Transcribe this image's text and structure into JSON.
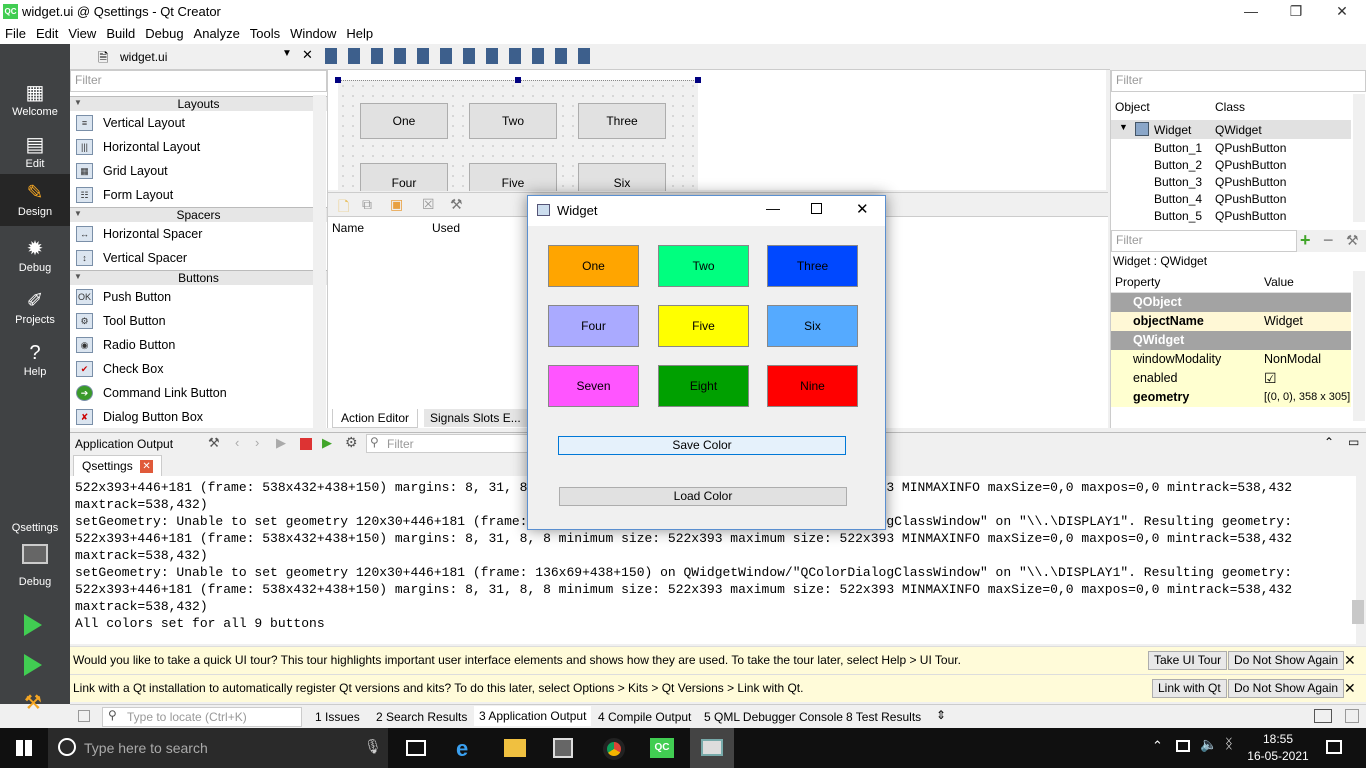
{
  "window": {
    "title": "widget.ui @ Qsettings - Qt Creator",
    "logo": "QC",
    "controls": [
      "—",
      "❐",
      "✕"
    ]
  },
  "menu": [
    "File",
    "Edit",
    "View",
    "Build",
    "Debug",
    "Analyze",
    "Tools",
    "Window",
    "Help"
  ],
  "modes": [
    {
      "label": "Welcome",
      "icon": "grid-icon"
    },
    {
      "label": "Edit",
      "icon": "document-icon"
    },
    {
      "label": "Design",
      "icon": "pencil-icon"
    },
    {
      "label": "Debug",
      "icon": "bug-icon"
    },
    {
      "label": "Projects",
      "icon": "wrench-icon"
    },
    {
      "label": "Help",
      "icon": "help-icon"
    }
  ],
  "kit": {
    "project": "Qsettings",
    "label": "Debug"
  },
  "editor": {
    "file": "widget.ui"
  },
  "widget_box": {
    "filter_placeholder": "Filter",
    "categories": [
      {
        "name": "Layouts",
        "items": [
          "Vertical Layout",
          "Horizontal Layout",
          "Grid Layout",
          "Form Layout"
        ]
      },
      {
        "name": "Spacers",
        "items": [
          "Horizontal Spacer",
          "Vertical Spacer"
        ]
      },
      {
        "name": "Buttons",
        "items": [
          "Push Button",
          "Tool Button",
          "Radio Button",
          "Check Box",
          "Command Link Button",
          "Dialog Button Box"
        ]
      }
    ]
  },
  "form_buttons": [
    "One",
    "Two",
    "Three",
    "Four",
    "Five",
    "Six"
  ],
  "action_editor": {
    "columns": [
      "Name",
      "Used"
    ],
    "tabs": [
      "Action Editor",
      "Signals Slots E..."
    ]
  },
  "object_inspector": {
    "filter_placeholder": "Filter",
    "columns": [
      "Object",
      "Class"
    ],
    "rows": [
      {
        "object": "Widget",
        "class": "QWidget"
      },
      {
        "object": "Button_1",
        "class": "QPushButton"
      },
      {
        "object": "Button_2",
        "class": "QPushButton"
      },
      {
        "object": "Button_3",
        "class": "QPushButton"
      },
      {
        "object": "Button_4",
        "class": "QPushButton"
      },
      {
        "object": "Button_5",
        "class": "QPushButton"
      }
    ]
  },
  "property_editor": {
    "filter_placeholder": "Filter",
    "caption": "Widget : QWidget",
    "columns": [
      "Property",
      "Value"
    ],
    "sections": [
      "QObject",
      "QWidget"
    ],
    "object_name": {
      "key": "objectName",
      "value": "Widget"
    },
    "window_modality": {
      "key": "windowModality",
      "value": "NonModal"
    },
    "enabled": {
      "key": "enabled",
      "value": "☑"
    },
    "geometry": {
      "key": "geometry",
      "value": "[(0, 0), 358 x 305]"
    }
  },
  "output": {
    "pane_title": "Application Output",
    "filter_placeholder": "Filter",
    "tab": "Qsettings",
    "lines": "522x393+446+181 (frame: 538x432+438+150) margins: 8, 31, 8, 8 minimum size: 522x393 maximum size: 522x393 MINMAXINFO maxSize=0,0 maxpos=0,0 mintrack=538,432\nmaxtrack=538,432)\nsetGeometry: Unable to set geometry 120x30+446+181 (frame: 136x69+438+150) on QWidgetWindow/\"QColorDialogClassWindow\" on \"\\\\.\\DISPLAY1\". Resulting geometry:\n522x393+446+181 (frame: 538x432+438+150) margins: 8, 31, 8, 8 minimum size: 522x393 maximum size: 522x393 MINMAXINFO maxSize=0,0 maxpos=0,0 mintrack=538,432\nmaxtrack=538,432)\nsetGeometry: Unable to set geometry 120x30+446+181 (frame: 136x69+438+150) on QWidgetWindow/\"QColorDialogClassWindow\" on \"\\\\.\\DISPLAY1\". Resulting geometry:\n522x393+446+181 (frame: 538x432+438+150) margins: 8, 31, 8, 8 minimum size: 522x393 maximum size: 522x393 MINMAXINFO maxSize=0,0 maxpos=0,0 mintrack=538,432\nmaxtrack=538,432)\nAll colors set for all 9 buttons"
  },
  "info_bars": [
    {
      "text": "Would you like to take a quick UI tour? This tour highlights important user interface elements and shows how they are used. To take the tour later, select Help > UI Tour.",
      "primary": "Take UI Tour",
      "secondary": "Do Not Show Again"
    },
    {
      "text": "Link with a Qt installation to automatically register Qt versions and kits? To do this later, select Options > Kits > Qt Versions > Link with Qt.",
      "primary": "Link with Qt",
      "secondary": "Do Not Show Again"
    }
  ],
  "status_bar": {
    "locator_placeholder": "Type to locate (Ctrl+K)",
    "panes": [
      "1  Issues",
      "2  Search Results",
      "3  Application Output",
      "4  Compile Output",
      "5  QML Debugger Console",
      "8  Test Results"
    ]
  },
  "dialog": {
    "title": "Widget",
    "buttons": [
      {
        "label": "One",
        "color": "#ffa500"
      },
      {
        "label": "Two",
        "color": "#00ff7f"
      },
      {
        "label": "Three",
        "color": "#0048ff"
      },
      {
        "label": "Four",
        "color": "#aaaaff"
      },
      {
        "label": "Five",
        "color": "#ffff00"
      },
      {
        "label": "Six",
        "color": "#55aaff"
      },
      {
        "label": "Seven",
        "color": "#ff55ff"
      },
      {
        "label": "Eight",
        "color": "#00a000"
      },
      {
        "label": "Nine",
        "color": "#ff0000"
      }
    ],
    "save_label": "Save Color",
    "load_label": "Load Color"
  },
  "taskbar": {
    "search_placeholder": "Type here to search",
    "time": "18:55",
    "date": "16-05-2021"
  }
}
